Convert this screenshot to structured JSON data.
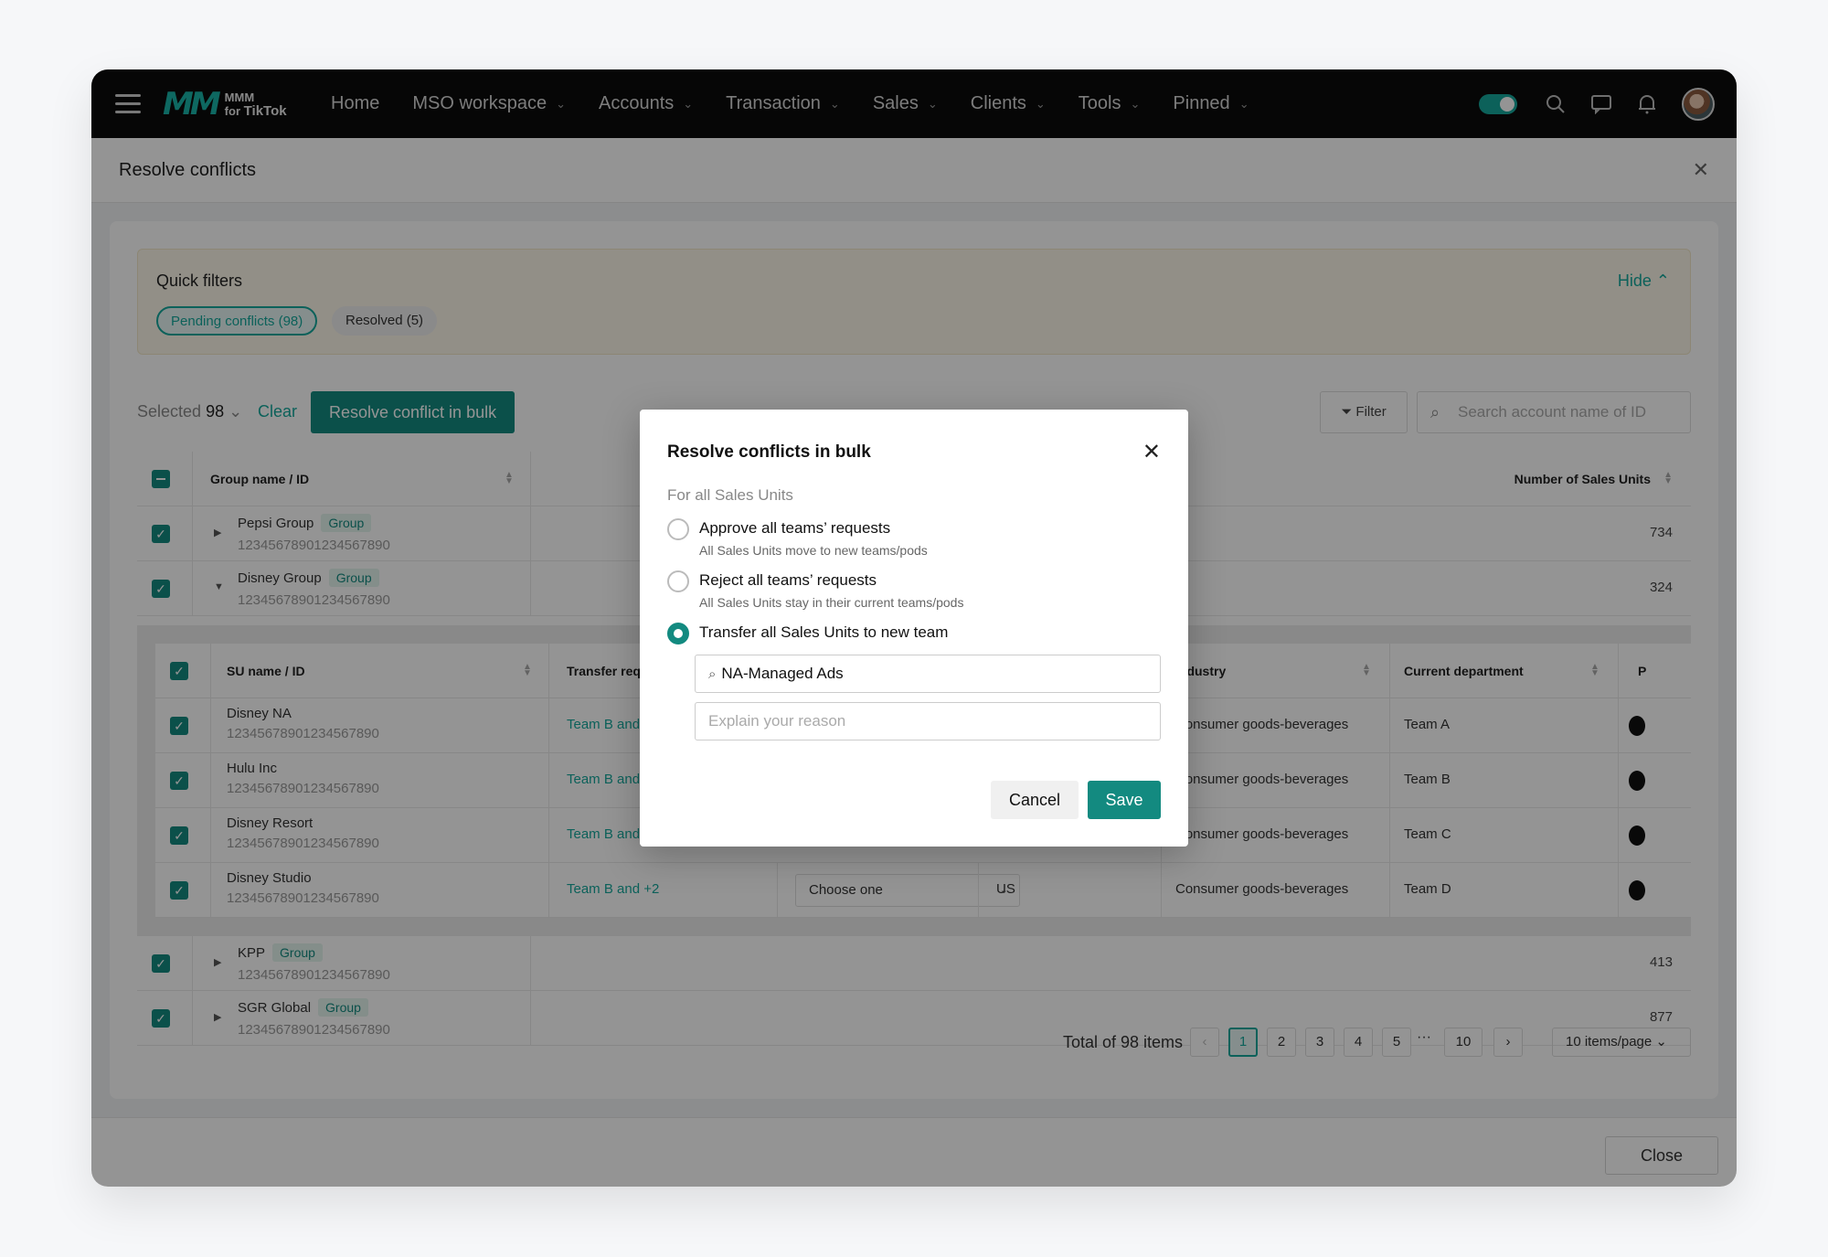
{
  "nav": {
    "logo_top": "MMM",
    "logo_for": "for",
    "logo_brand": "TikTok",
    "items": [
      {
        "label": "Home"
      },
      {
        "label": "MSO workspace"
      },
      {
        "label": "Accounts"
      },
      {
        "label": "Transaction"
      },
      {
        "label": "Sales"
      },
      {
        "label": "Clients"
      },
      {
        "label": "Tools"
      },
      {
        "label": "Pinned"
      }
    ]
  },
  "page": {
    "title": "Resolve conflicts",
    "footer_close": "Close"
  },
  "quick_filters": {
    "title": "Quick filters",
    "hide": "Hide",
    "chip_pending": "Pending conflicts (98)",
    "chip_resolved": "Resolved (5)"
  },
  "toolbar": {
    "selected_label": "Selected",
    "selected_count": "98",
    "clear": "Clear",
    "bulk": "Resolve conflict in bulk",
    "filter": "Filter",
    "search_placeholder": "Search account name of ID"
  },
  "table": {
    "col_group": "Group name / ID",
    "col_units": "Number of Sales Units",
    "groups": [
      {
        "name": "Pepsi Group",
        "tag": "Group",
        "id": "12345678901234567890",
        "units": "734"
      },
      {
        "name": "Disney Group",
        "tag": "Group",
        "id": "12345678901234567890",
        "units": "324"
      },
      {
        "name": "KPP",
        "tag": "Group",
        "id": "12345678901234567890",
        "units": "413"
      },
      {
        "name": "SGR Global",
        "tag": "Group",
        "id": "12345678901234567890",
        "units": "877"
      }
    ]
  },
  "subtable": {
    "col_su": "SU name / ID",
    "col_transfer": "Transfer requ",
    "col_industry": "Industry",
    "col_dept": "Current department",
    "col_p": "P",
    "rows": [
      {
        "name": "Disney NA",
        "id": "12345678901234567890",
        "transfer": "Team B and +",
        "industry": "Consumer goods-beverages",
        "dept": "Team A"
      },
      {
        "name": "Hulu Inc",
        "id": "12345678901234567890",
        "transfer": "Team B and +",
        "industry": "Consumer goods-beverages",
        "dept": "Team B"
      },
      {
        "name": "Disney Resort",
        "id": "12345678901234567890",
        "transfer": "Team B and +",
        "industry": "Consumer goods-beverages",
        "dept": "Team C"
      },
      {
        "name": "Disney Studio",
        "id": "12345678901234567890",
        "transfer": "Team B and +2",
        "choose": "Choose one",
        "region": "US",
        "industry": "Consumer goods-beverages",
        "dept": "Team D"
      }
    ]
  },
  "pagination": {
    "total": "Total of 98 items",
    "pages": [
      "1",
      "2",
      "3",
      "4",
      "5"
    ],
    "dots": "···",
    "last": "10",
    "page_size": "10 items/page",
    "current": "1"
  },
  "modal": {
    "title": "Resolve conflicts in bulk",
    "subtitle": "For all Sales Units",
    "options": [
      {
        "label": "Approve all teams’ requests",
        "desc": "All Sales Units move to new teams/pods",
        "selected": false
      },
      {
        "label": "Reject all teams’ requests",
        "desc": "All Sales Units stay in their current teams/pods",
        "selected": false
      },
      {
        "label": "Transfer all Sales Units to new team",
        "selected": true
      }
    ],
    "team_value": "NA-Managed Ads",
    "reason_placeholder": "Explain your reason",
    "cancel": "Cancel",
    "save": "Save"
  },
  "colors": {
    "accent": "#16a89c",
    "accent_dark": "#138a80",
    "nav_bg": "#0b0b0b",
    "overlay": "rgba(0,0,0,0.42)"
  }
}
